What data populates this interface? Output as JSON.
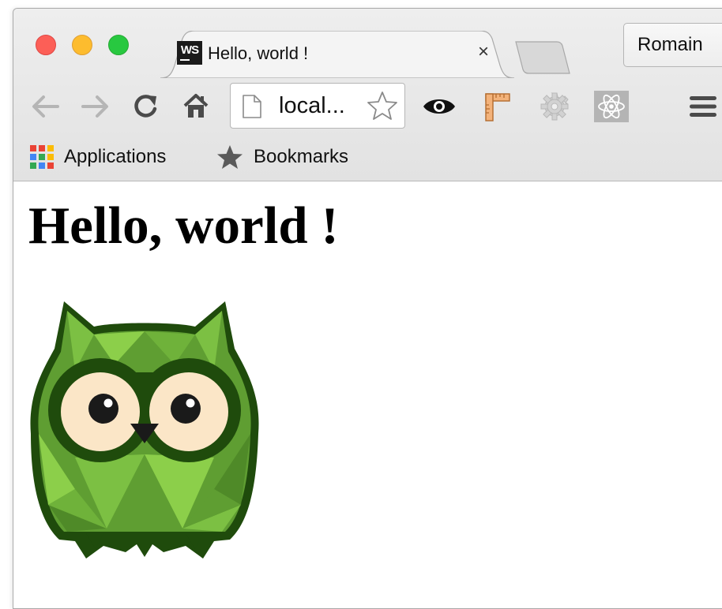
{
  "window": {
    "controls": [
      "close",
      "minimize",
      "zoom"
    ]
  },
  "tab": {
    "favicon_text": "WS",
    "title": "Hello, world !",
    "close_glyph": "×"
  },
  "profile": {
    "name": "Romain"
  },
  "toolbar": {
    "back_icon": "arrow-left-icon",
    "forward_icon": "arrow-right-icon",
    "reload_icon": "reload-icon",
    "home_icon": "home-icon",
    "url": "local...",
    "extensions": [
      "eye-icon",
      "ruler-icon",
      "gear-icon",
      "react-icon"
    ],
    "menu_icon": "hamburger-menu-icon"
  },
  "bookmarks_bar": {
    "items": [
      {
        "label": "Applications",
        "icon": "apps-grid-icon"
      },
      {
        "label": "Bookmarks",
        "icon": "star-icon"
      }
    ]
  },
  "page": {
    "heading": "Hello, world !",
    "image": "owl-logo"
  },
  "colors": {
    "close": "#fc5f57",
    "minimize": "#fdbc2e",
    "zoom": "#28c840",
    "owl_green": "#6cac3c",
    "owl_dark": "#1f4b0c"
  }
}
